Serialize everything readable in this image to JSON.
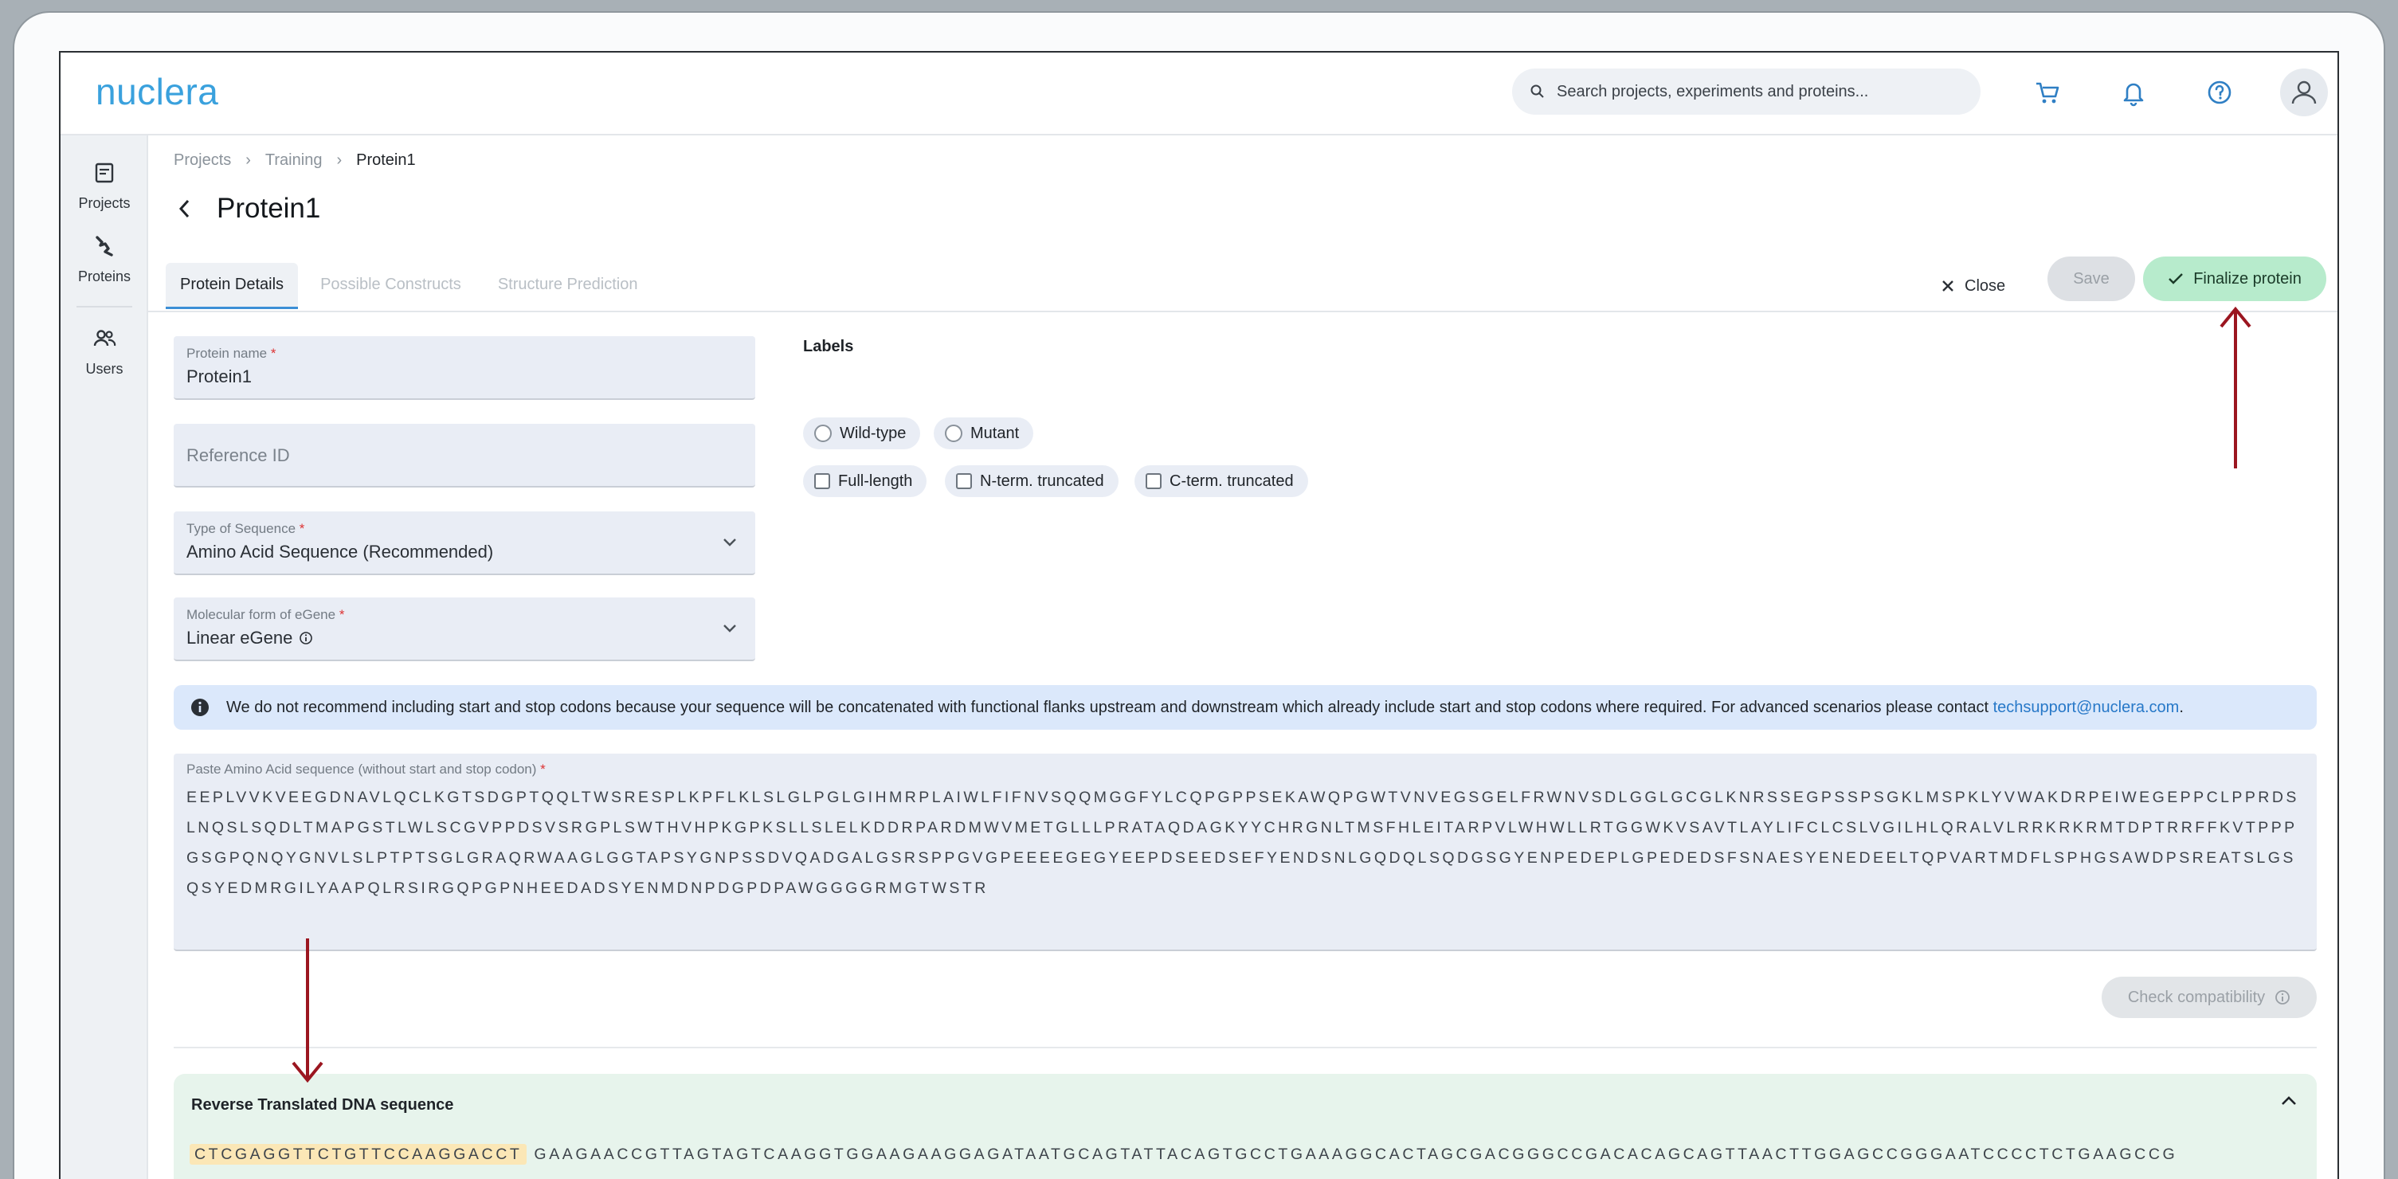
{
  "app": {
    "logo": "nuclera",
    "search_placeholder": "Search projects, experiments and proteins..."
  },
  "sidebar": {
    "items": [
      {
        "label": "Projects",
        "icon": "projects-icon"
      },
      {
        "label": "Proteins",
        "icon": "proteins-icon"
      },
      {
        "label": "Users",
        "icon": "users-icon"
      }
    ]
  },
  "breadcrumb": [
    "Projects",
    "Training",
    "Protein1"
  ],
  "page": {
    "title": "Protein1"
  },
  "tabs": [
    {
      "label": "Protein Details",
      "active": true
    },
    {
      "label": "Possible Constructs",
      "active": false
    },
    {
      "label": "Structure Prediction",
      "active": false
    }
  ],
  "actions": {
    "close": "Close",
    "save": "Save",
    "finalize": "Finalize protein"
  },
  "form": {
    "protein_name": {
      "label": "Protein name",
      "required": "*",
      "value": "Protein1"
    },
    "reference_id": {
      "placeholder": "Reference ID"
    },
    "sequence_type": {
      "label": "Type of Sequence",
      "required": "*",
      "value": "Amino Acid Sequence (Recommended)"
    },
    "molecular_form": {
      "label": "Molecular form of eGene",
      "required": "*",
      "value": "Linear eGene"
    }
  },
  "labels": {
    "title": "Labels",
    "radios": [
      "Wild-type",
      "Mutant"
    ],
    "checkboxes": [
      "Full-length",
      "N-term. truncated",
      "C-term. truncated"
    ]
  },
  "info": {
    "text": "We do not recommend including start and stop codons because your sequence will be concatenated with functional flanks upstream and downstream which already include start and stop codons where required. For advanced scenarios please contact ",
    "email": "techsupport@nuclera.com",
    "suffix": "."
  },
  "sequence": {
    "label": "Paste Amino Acid sequence (without start and stop codon)",
    "required": "*",
    "value": "EEPLVVKVEEGDNAVLQCLKGTSDGPTQQLTWSRESPLKPFLKLSLGLPGLGIHMRPLAIWLFIFNVSQQMGGFYLCQPGPPSEKAWQPGWTVNVEGSGELFRWNVSDLGGLGCGLKNRSSEGPSSPSGKLMSPKLYVWAKDRPEIWEGEPPCLPPRDSLNQSLSQDLTMAPGSTLWLSCGVPPDSVSRGPLSWTHVHPKGPKSLLSLELKDDRPARDMWVMETGLLLPRATAQDAGKYYCHRGNLTMSFHLEITARPVLWHWLLRTGGWKVSAVTLAYLIFCLCSLVGILHLQRALVLRRKRKRMTDPTRRFFKVTPPPGSGPQNQYGNVLSLPTPTSGLGRAQRWAAGLGGTAPSYGNPSSDVQADGALGSRSPPGVGPEEEEGEGYEEPDSEEDSEFYENDSNLGQDQLSQDGSGYENPEDEPLGPEDEDSFSNAESYENEDEELTQPVARTMDFLSPHGSAWDPSREATSLGSQSYEDMRGILYAAPQLRSIRGQPGPNHEEDADSYENMDNPDGPDPAWGGGGRMGTWSTR"
  },
  "check_compat": "Check compatibility",
  "reverse": {
    "title": "Reverse Translated DNA sequence",
    "highlight": "CTCGAGGTTCTGTTCCAAGGACCT",
    "rest": "GAAGAACCGTTAGTAGTCAAGGTGGAAGAAGGAGATAATGCAGTATTACAGTGCCTGAAAGGCACTAGCGACGGGCCGACACAGCAGTTAACTTGGAGCCGGGAATCCCCTCTGAAGCCG"
  },
  "colors": {
    "accent": "#3aa1dd",
    "finalize_bg": "#b7ebcc",
    "info_bg": "#dbe8fb",
    "reverse_bg": "#e7f4ec",
    "highlight": "#fbe7b6",
    "annotation_arrow": "#9b1620"
  }
}
